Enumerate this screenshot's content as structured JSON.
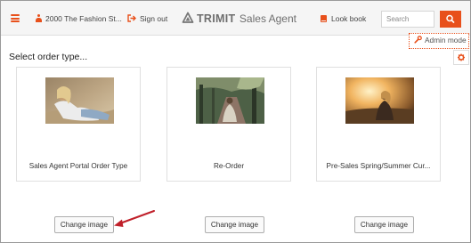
{
  "header": {
    "store_label": "2000 The Fashion St...",
    "signout_label": "Sign out",
    "logo_brand": "TRIMIT",
    "logo_product": "Sales Agent",
    "lookbook_label": "Look book",
    "search": {
      "placeholder": "Search",
      "value": ""
    }
  },
  "admin": {
    "label": "Admin mode"
  },
  "main": {
    "heading": "Select order type...",
    "cards": [
      {
        "label": "Sales Agent Portal Order Type",
        "image_icon": "woman-sitting-photo",
        "button_label": "Change image"
      },
      {
        "label": "Re-Order",
        "image_icon": "woman-on-garden-path-photo",
        "button_label": "Change image"
      },
      {
        "label": "Pre-Sales Spring/Summer Cur...",
        "image_icon": "woman-at-sunset-photo",
        "button_label": "Change image"
      }
    ]
  },
  "colors": {
    "accent": "#e8501b",
    "topbar_bg": "#f5f5f5",
    "annotation_arrow": "#c0202a"
  },
  "icons": {
    "menu": "hamburger-menu-icon",
    "user": "user-icon",
    "signout": "sign-out-icon",
    "logo": "trimit-logo-icon",
    "lookbook": "book-icon",
    "search": "search-icon",
    "admin": "wrench-icon",
    "settings": "gear-icon"
  }
}
